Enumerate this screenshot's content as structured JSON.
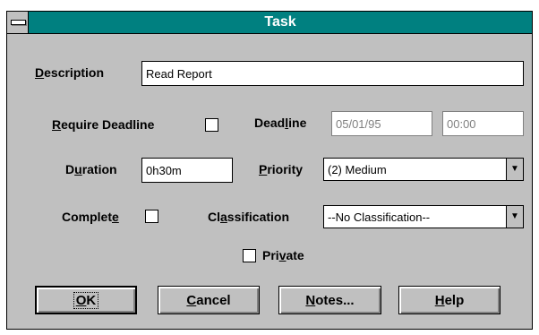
{
  "window": {
    "title": "Task"
  },
  "description": {
    "label_pre": "",
    "label_ul": "D",
    "label_post": "escription",
    "value": "Read Report"
  },
  "require_deadline": {
    "label_pre": "",
    "label_ul": "R",
    "label_post": "equire Deadline",
    "checked": false
  },
  "deadline": {
    "label_pre": "Dead",
    "label_ul": "l",
    "label_post": "ine",
    "date": "05/01/95",
    "time": "00:00"
  },
  "duration": {
    "label_pre": "D",
    "label_ul": "u",
    "label_post": "ration",
    "value": "0h30m"
  },
  "priority": {
    "label_pre": "",
    "label_ul": "P",
    "label_post": "riority",
    "value": "(2) Medium"
  },
  "complete": {
    "label_pre": "Complet",
    "label_ul": "e",
    "label_post": "",
    "checked": false
  },
  "classification": {
    "label_pre": "Cl",
    "label_ul": "a",
    "label_post": "ssification",
    "value": "--No Classification--"
  },
  "private": {
    "label_pre": "Pri",
    "label_ul": "v",
    "label_post": "ate",
    "checked": false
  },
  "buttons": {
    "ok": {
      "pre": "",
      "ul": "O",
      "post": "K"
    },
    "cancel": {
      "pre": "",
      "ul": "C",
      "post": "ancel"
    },
    "notes": {
      "pre": "",
      "ul": "N",
      "post": "otes..."
    },
    "help": {
      "pre": "",
      "ul": "H",
      "post": "elp"
    }
  },
  "icons": {
    "system_menu": "system-menu-icon",
    "dropdown_arrow": "dropdown-arrow-icon"
  }
}
